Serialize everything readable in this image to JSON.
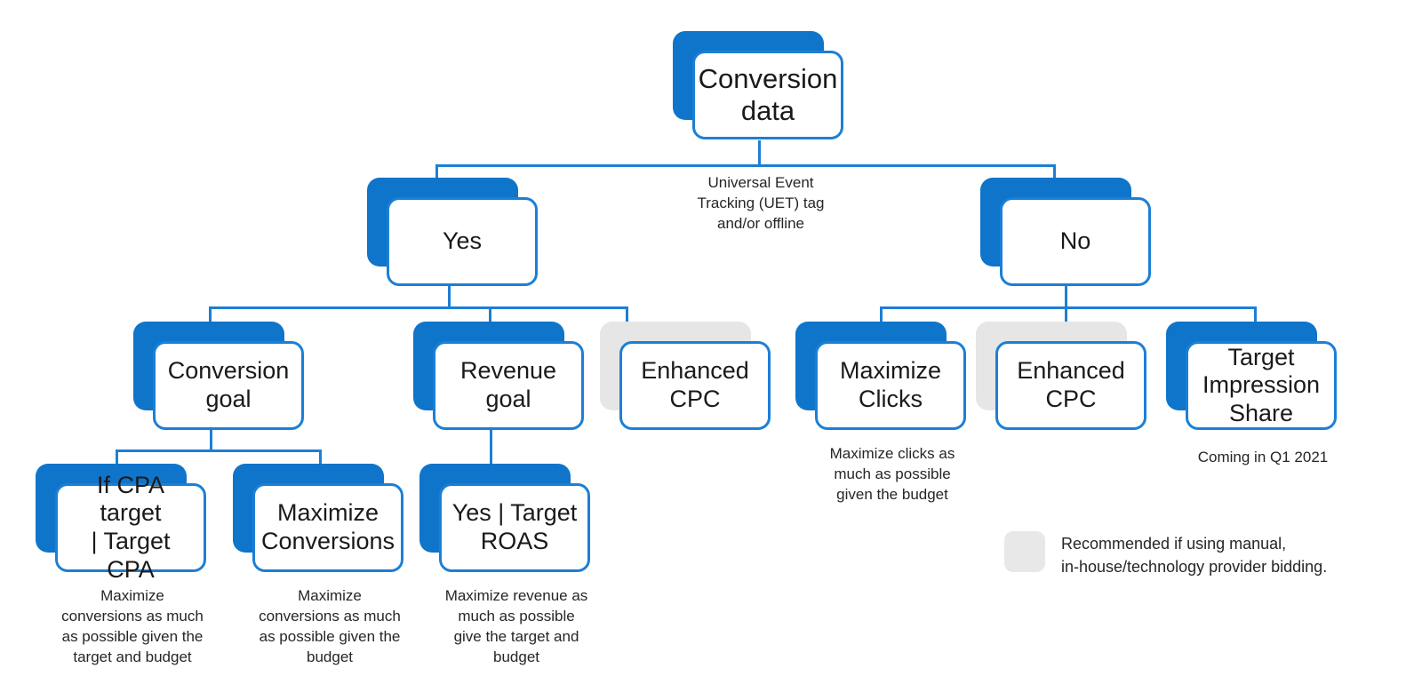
{
  "diagram": {
    "title": "Bidding strategy decision tree",
    "accent_blue": "#1c7fd6",
    "shadow_blue": "#0f75ca",
    "shadow_grey": "#e6e6e6"
  },
  "nodes": {
    "root": {
      "label": "Conversion\ndata"
    },
    "yes": {
      "label": "Yes"
    },
    "no": {
      "label": "No"
    },
    "conversion_goal": {
      "label": "Conversion\ngoal"
    },
    "revenue_goal": {
      "label": "Revenue\ngoal"
    },
    "enhanced_cpc_left": {
      "label": "Enhanced\nCPC"
    },
    "maximize_clicks": {
      "label": "Maximize\nClicks"
    },
    "enhanced_cpc_right": {
      "label": "Enhanced\nCPC"
    },
    "target_impression_share": {
      "label": "Target\nImpression\nShare"
    },
    "target_cpa": {
      "label": "If CPA  target\n| Target CPA"
    },
    "maximize_conversions": {
      "label": "Maximize\nConversions"
    },
    "target_roas": {
      "label": "Yes | Target\nROAS"
    }
  },
  "edge_labels": {
    "uet": "Universal Event\nTracking (UET) tag\nand/or offline"
  },
  "captions": {
    "target_cpa": "Maximize\nconversions as much\nas possible given the\ntarget and budget",
    "maximize_conversions": "Maximize\nconversions as much\nas possible given the\nbudget",
    "target_roas": "Maximize revenue as\nmuch as possible\ngive the target and\nbudget",
    "maximize_clicks": "Maximize clicks as\nmuch as possible\ngiven the budget",
    "target_impression_share": "Coming in Q1 2021"
  },
  "legend": {
    "swatch_color": "#e8e8e8",
    "text": "Recommended if using manual,\nin-house/technology provider bidding."
  }
}
